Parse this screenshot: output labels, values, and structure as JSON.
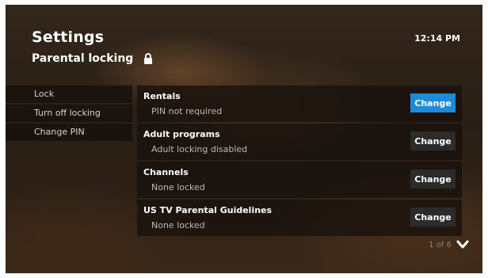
{
  "header": {
    "title": "Settings",
    "subtitle": "Parental locking",
    "subtitle_icon": "lock-icon",
    "clock": "12:14 PM"
  },
  "side_menu": {
    "items": [
      {
        "label": "Lock"
      },
      {
        "label": "Turn off locking"
      },
      {
        "label": "Change PIN"
      }
    ]
  },
  "settings": {
    "rows": [
      {
        "title": "Rentals",
        "status": "PIN not required",
        "button": "Change",
        "focused": true
      },
      {
        "title": "Adult programs",
        "status": "Adult locking disabled",
        "button": "Change",
        "focused": false
      },
      {
        "title": "Channels",
        "status": "None locked",
        "button": "Change",
        "focused": false
      },
      {
        "title": "US TV Parental Guidelines",
        "status": "None locked",
        "button": "Change",
        "focused": false
      }
    ]
  },
  "pager": {
    "label": "1 of 6",
    "icon": "chevron-down-icon"
  },
  "colors": {
    "accent": "#1f8ad6",
    "button": "#2b2b2b",
    "panel": "#18120d"
  }
}
